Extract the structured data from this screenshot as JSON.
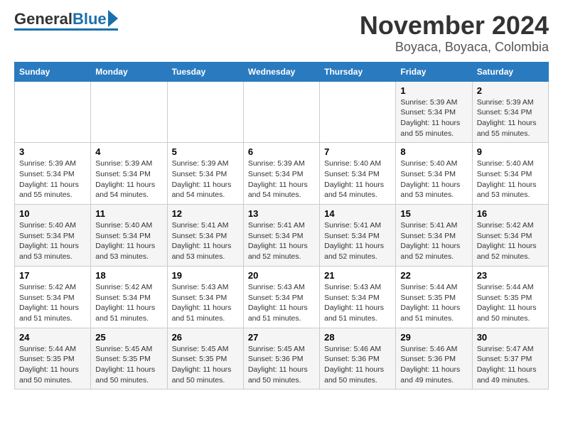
{
  "header": {
    "logo_general": "General",
    "logo_blue": "Blue",
    "title": "November 2024",
    "subtitle": "Boyaca, Boyaca, Colombia"
  },
  "weekdays": [
    "Sunday",
    "Monday",
    "Tuesday",
    "Wednesday",
    "Thursday",
    "Friday",
    "Saturday"
  ],
  "weeks": [
    [
      {
        "day": "",
        "detail": ""
      },
      {
        "day": "",
        "detail": ""
      },
      {
        "day": "",
        "detail": ""
      },
      {
        "day": "",
        "detail": ""
      },
      {
        "day": "",
        "detail": ""
      },
      {
        "day": "1",
        "detail": "Sunrise: 5:39 AM\nSunset: 5:34 PM\nDaylight: 11 hours\nand 55 minutes."
      },
      {
        "day": "2",
        "detail": "Sunrise: 5:39 AM\nSunset: 5:34 PM\nDaylight: 11 hours\nand 55 minutes."
      }
    ],
    [
      {
        "day": "3",
        "detail": "Sunrise: 5:39 AM\nSunset: 5:34 PM\nDaylight: 11 hours\nand 55 minutes."
      },
      {
        "day": "4",
        "detail": "Sunrise: 5:39 AM\nSunset: 5:34 PM\nDaylight: 11 hours\nand 54 minutes."
      },
      {
        "day": "5",
        "detail": "Sunrise: 5:39 AM\nSunset: 5:34 PM\nDaylight: 11 hours\nand 54 minutes."
      },
      {
        "day": "6",
        "detail": "Sunrise: 5:39 AM\nSunset: 5:34 PM\nDaylight: 11 hours\nand 54 minutes."
      },
      {
        "day": "7",
        "detail": "Sunrise: 5:40 AM\nSunset: 5:34 PM\nDaylight: 11 hours\nand 54 minutes."
      },
      {
        "day": "8",
        "detail": "Sunrise: 5:40 AM\nSunset: 5:34 PM\nDaylight: 11 hours\nand 53 minutes."
      },
      {
        "day": "9",
        "detail": "Sunrise: 5:40 AM\nSunset: 5:34 PM\nDaylight: 11 hours\nand 53 minutes."
      }
    ],
    [
      {
        "day": "10",
        "detail": "Sunrise: 5:40 AM\nSunset: 5:34 PM\nDaylight: 11 hours\nand 53 minutes."
      },
      {
        "day": "11",
        "detail": "Sunrise: 5:40 AM\nSunset: 5:34 PM\nDaylight: 11 hours\nand 53 minutes."
      },
      {
        "day": "12",
        "detail": "Sunrise: 5:41 AM\nSunset: 5:34 PM\nDaylight: 11 hours\nand 53 minutes."
      },
      {
        "day": "13",
        "detail": "Sunrise: 5:41 AM\nSunset: 5:34 PM\nDaylight: 11 hours\nand 52 minutes."
      },
      {
        "day": "14",
        "detail": "Sunrise: 5:41 AM\nSunset: 5:34 PM\nDaylight: 11 hours\nand 52 minutes."
      },
      {
        "day": "15",
        "detail": "Sunrise: 5:41 AM\nSunset: 5:34 PM\nDaylight: 11 hours\nand 52 minutes."
      },
      {
        "day": "16",
        "detail": "Sunrise: 5:42 AM\nSunset: 5:34 PM\nDaylight: 11 hours\nand 52 minutes."
      }
    ],
    [
      {
        "day": "17",
        "detail": "Sunrise: 5:42 AM\nSunset: 5:34 PM\nDaylight: 11 hours\nand 51 minutes."
      },
      {
        "day": "18",
        "detail": "Sunrise: 5:42 AM\nSunset: 5:34 PM\nDaylight: 11 hours\nand 51 minutes."
      },
      {
        "day": "19",
        "detail": "Sunrise: 5:43 AM\nSunset: 5:34 PM\nDaylight: 11 hours\nand 51 minutes."
      },
      {
        "day": "20",
        "detail": "Sunrise: 5:43 AM\nSunset: 5:34 PM\nDaylight: 11 hours\nand 51 minutes."
      },
      {
        "day": "21",
        "detail": "Sunrise: 5:43 AM\nSunset: 5:34 PM\nDaylight: 11 hours\nand 51 minutes."
      },
      {
        "day": "22",
        "detail": "Sunrise: 5:44 AM\nSunset: 5:35 PM\nDaylight: 11 hours\nand 51 minutes."
      },
      {
        "day": "23",
        "detail": "Sunrise: 5:44 AM\nSunset: 5:35 PM\nDaylight: 11 hours\nand 50 minutes."
      }
    ],
    [
      {
        "day": "24",
        "detail": "Sunrise: 5:44 AM\nSunset: 5:35 PM\nDaylight: 11 hours\nand 50 minutes."
      },
      {
        "day": "25",
        "detail": "Sunrise: 5:45 AM\nSunset: 5:35 PM\nDaylight: 11 hours\nand 50 minutes."
      },
      {
        "day": "26",
        "detail": "Sunrise: 5:45 AM\nSunset: 5:35 PM\nDaylight: 11 hours\nand 50 minutes."
      },
      {
        "day": "27",
        "detail": "Sunrise: 5:45 AM\nSunset: 5:36 PM\nDaylight: 11 hours\nand 50 minutes."
      },
      {
        "day": "28",
        "detail": "Sunrise: 5:46 AM\nSunset: 5:36 PM\nDaylight: 11 hours\nand 50 minutes."
      },
      {
        "day": "29",
        "detail": "Sunrise: 5:46 AM\nSunset: 5:36 PM\nDaylight: 11 hours\nand 49 minutes."
      },
      {
        "day": "30",
        "detail": "Sunrise: 5:47 AM\nSunset: 5:37 PM\nDaylight: 11 hours\nand 49 minutes."
      }
    ]
  ]
}
